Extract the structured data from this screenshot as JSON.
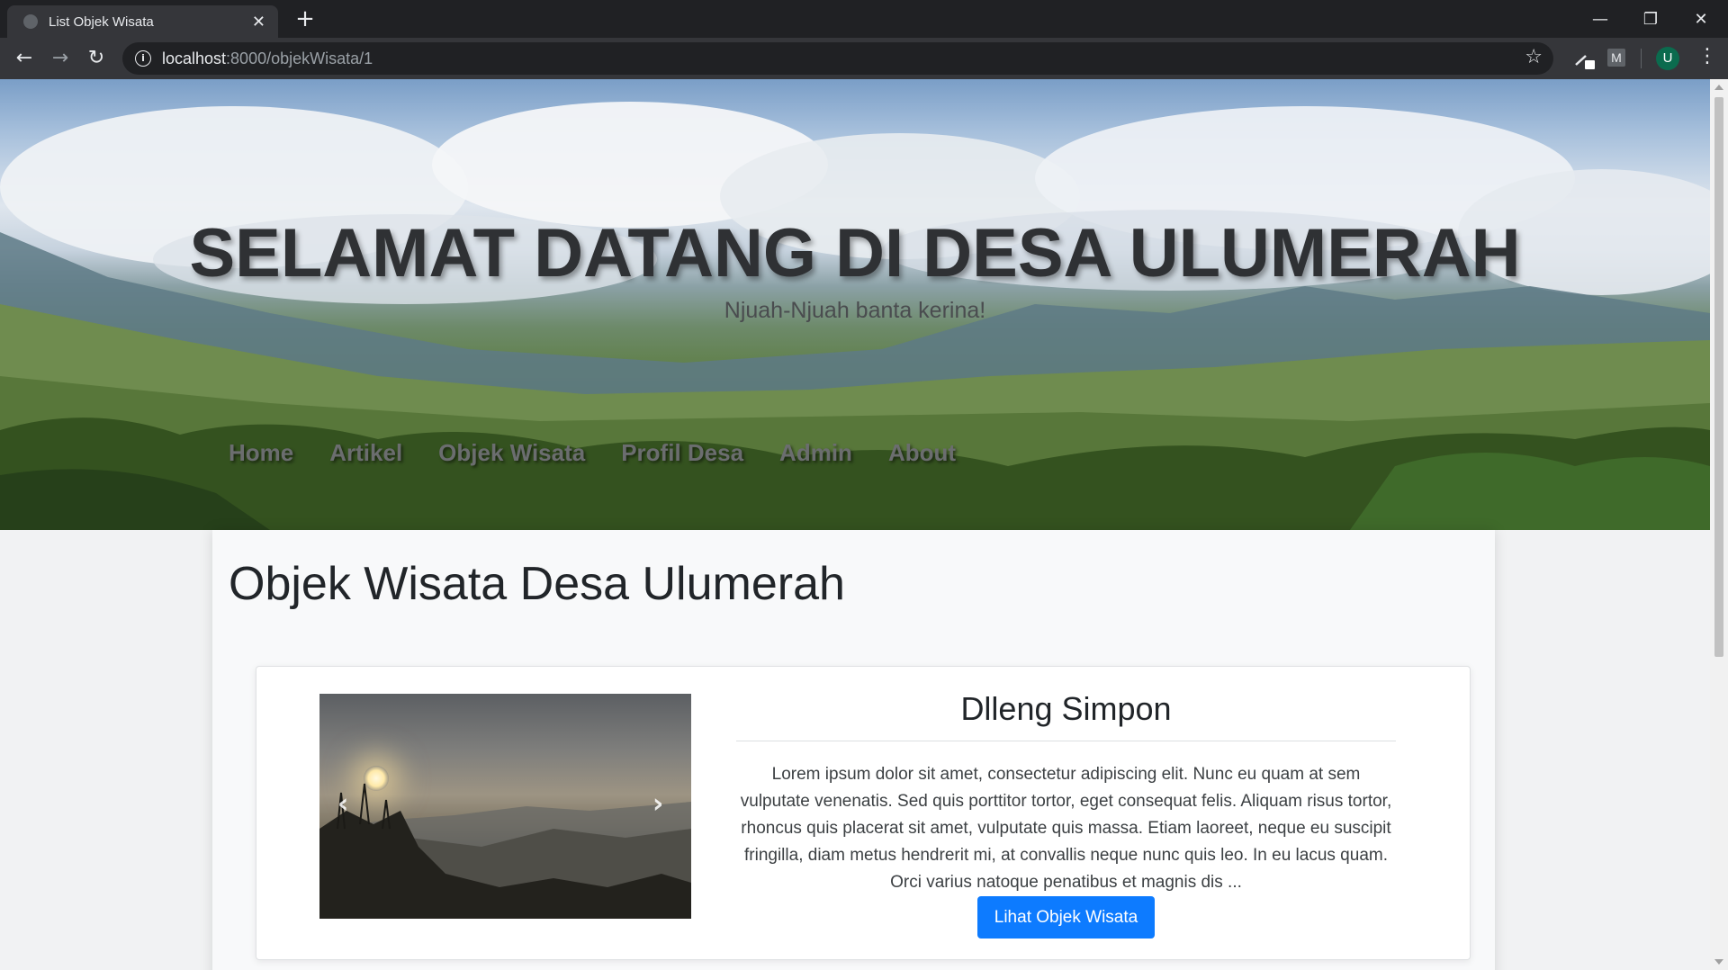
{
  "browser": {
    "tab_title": "List Objek Wisata",
    "tab_close": "✕",
    "new_tab": "+",
    "url_host": "localhost",
    "url_path": ":8000/objekWisata/1",
    "window_controls": {
      "minimize": "—",
      "restore": "❐",
      "close": "✕"
    },
    "ext_m_label": "M",
    "profile_initial": "U"
  },
  "hero": {
    "title": "SELAMAT DATANG DI DESA ULUMERAH",
    "subtitle": "Njuah-Njuah banta kerina!",
    "nav": [
      "Home",
      "Artikel",
      "Objek Wisata",
      "Profil Desa",
      "Admin",
      "About"
    ]
  },
  "main": {
    "page_title": "Objek Wisata Desa Ulumerah",
    "card": {
      "title": "Dlleng Simpon",
      "description": "Lorem ipsum dolor sit amet, consectetur adipiscing elit. Nunc eu quam at sem vulputate venenatis. Sed quis porttitor tortor, eget consequat felis. Aliquam risus tortor, rhoncus quis placerat sit amet, vulputate quis massa. Etiam laoreet, neque eu suscipit fringilla, diam metus hendrerit mi, at convallis neque nunc quis leo. In eu lacus quam. Orci varius natoque penatibus et magnis dis ...",
      "button_label": "Lihat Objek Wisata",
      "carousel_prev": "‹",
      "carousel_next": "›"
    }
  },
  "colors": {
    "chrome_dark": "#202124",
    "chrome_tab": "#35363a",
    "button_primary": "#0d7bff",
    "page_bg": "#f8f9fa"
  }
}
